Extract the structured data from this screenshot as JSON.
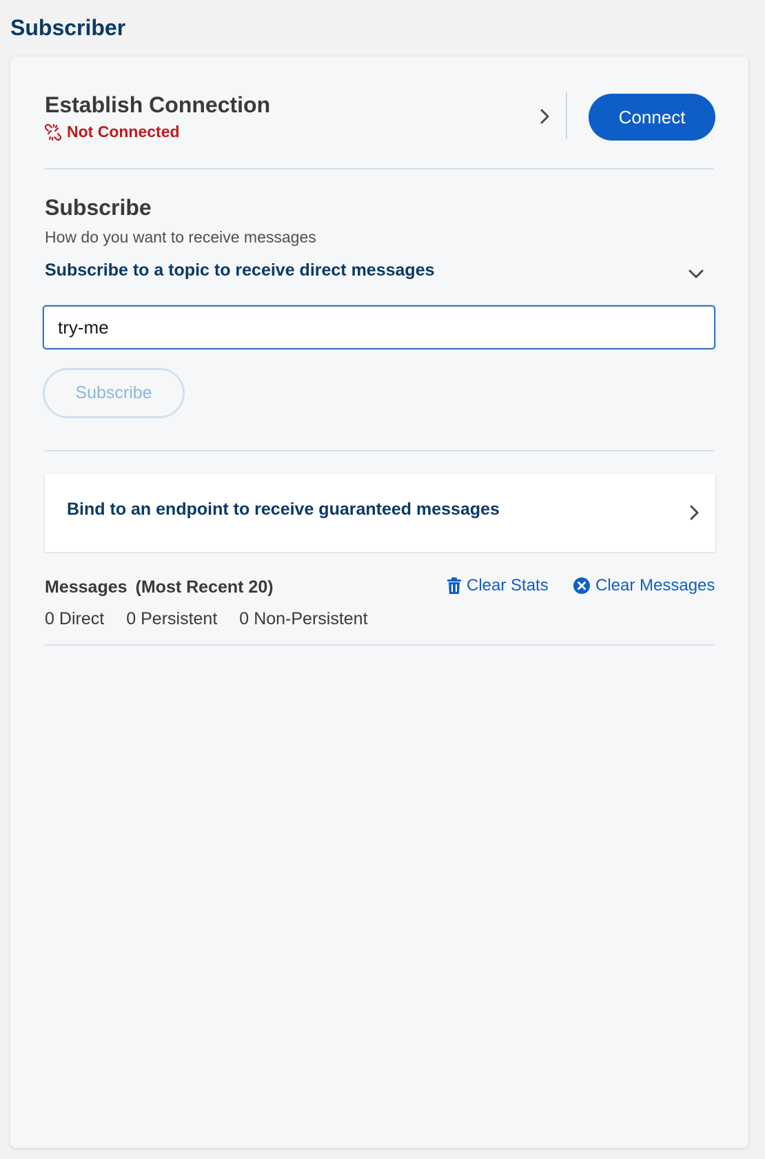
{
  "app": {
    "title": "Subscriber"
  },
  "connection": {
    "title": "Establish Connection",
    "status": "Not Connected",
    "status_icon": "broken-link-icon",
    "connect_label": "Connect"
  },
  "subscribe": {
    "title": "Subscribe",
    "description": "How do you want to receive messages",
    "accordion_label": "Subscribe to a topic to receive direct messages",
    "topic_value": "try-me",
    "subscribe_label": "Subscribe"
  },
  "bind": {
    "label": "Bind to an endpoint to receive guaranteed messages"
  },
  "messages": {
    "title": "Messages",
    "subtitle": "(Most Recent 20)",
    "clear_stats_label": "Clear Stats",
    "clear_messages_label": "Clear Messages",
    "counts": [
      {
        "value": "0",
        "label": "Direct"
      },
      {
        "value": "0",
        "label": "Persistent"
      },
      {
        "value": "0",
        "label": "Non-Persistent"
      }
    ]
  },
  "colors": {
    "brand_dark": "#0b3a66",
    "primary": "#0f5ec8",
    "error": "#c11a1a",
    "link": "#1060c4"
  }
}
